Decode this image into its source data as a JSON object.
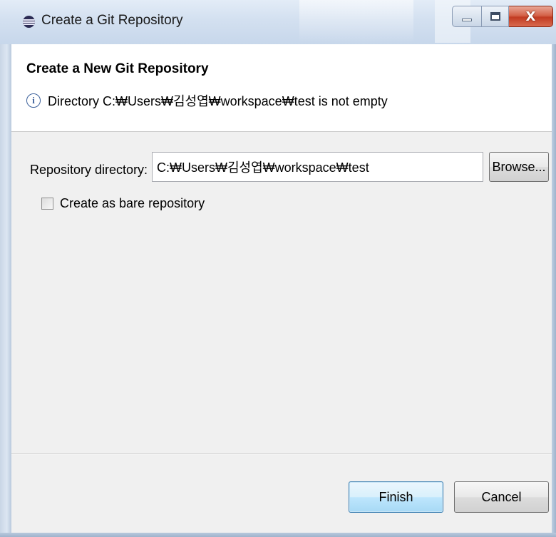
{
  "window": {
    "title": "Create a Git Repository",
    "close_glyph": "X",
    "accent_color": "#3c7fb1"
  },
  "header": {
    "title": "Create a New Git Repository",
    "info_icon_glyph": "i",
    "info_message": "Directory C:₩Users₩김성엽₩workspace₩test is not empty"
  },
  "form": {
    "repo_label": "Repository directory:",
    "repo_value": "C:₩Users₩김성엽₩workspace₩test",
    "browse_label": "Browse...",
    "bare_label": "Create as bare repository",
    "bare_checked": false
  },
  "footer": {
    "finish_label": "Finish",
    "cancel_label": "Cancel"
  },
  "icons": [
    "eclipse-app-icon",
    "minimize-icon",
    "maximize-icon",
    "close-icon",
    "info-icon",
    "checkbox-icon"
  ]
}
